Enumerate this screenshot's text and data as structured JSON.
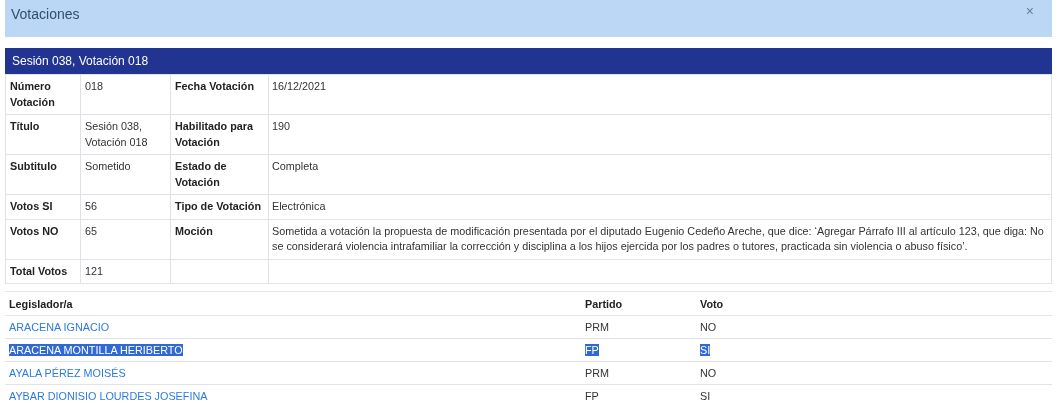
{
  "dialog": {
    "title": "Votaciones",
    "close": "×"
  },
  "summary": {
    "heading": "Sesión 038, Votación 018",
    "rows": [
      {
        "label_1": "Número Votación",
        "value_1": "018",
        "label_2": "Fecha Votación",
        "value_2": "16/12/2021"
      },
      {
        "label_1": "Título",
        "value_1": "Sesión 038, Votación 018",
        "label_2": "Habilitado para Votación",
        "value_2": "190"
      },
      {
        "label_1": "Subtitulo",
        "value_1": "Sometido",
        "label_2": "Estado de Votación",
        "value_2": "Completa"
      },
      {
        "label_1": "Votos SI",
        "value_1": "56",
        "label_2": "Tipo de Votación",
        "value_2": "Electrónica"
      },
      {
        "label_1": "Votos NO",
        "value_1": "65",
        "label_2": "Moción",
        "value_2": "Sometida a votación la propuesta de modificación presentada por el diputado Eugenio Cedeño Areche, que dice: ‘Agregar Párrafo III al artículo 123, que diga: No se considerará violencia intrafamiliar la corrección y disciplina a los hijos ejercida por los padres o tutores, practicada sin violencia o abuso físico’."
      },
      {
        "label_1": "Total Votos",
        "value_1": "121"
      }
    ]
  },
  "votes": {
    "columns": [
      "Legislador/a",
      "Partido",
      "Voto"
    ],
    "rows": [
      {
        "legislator": "ARACENA IGNACIO",
        "party": "PRM",
        "vote": "NO",
        "selected": false
      },
      {
        "legislator": "ARACENA MONTILLA HERIBERTO",
        "party": "FP",
        "vote": "SI",
        "selected": true
      },
      {
        "legislator": "AYALA PÉREZ MOISÉS",
        "party": "PRM",
        "vote": "NO",
        "selected": false
      },
      {
        "legislator": "AYBAR DIONISIO LOURDES JOSEFINA",
        "party": "FP",
        "vote": "SI",
        "selected": false
      }
    ]
  }
}
